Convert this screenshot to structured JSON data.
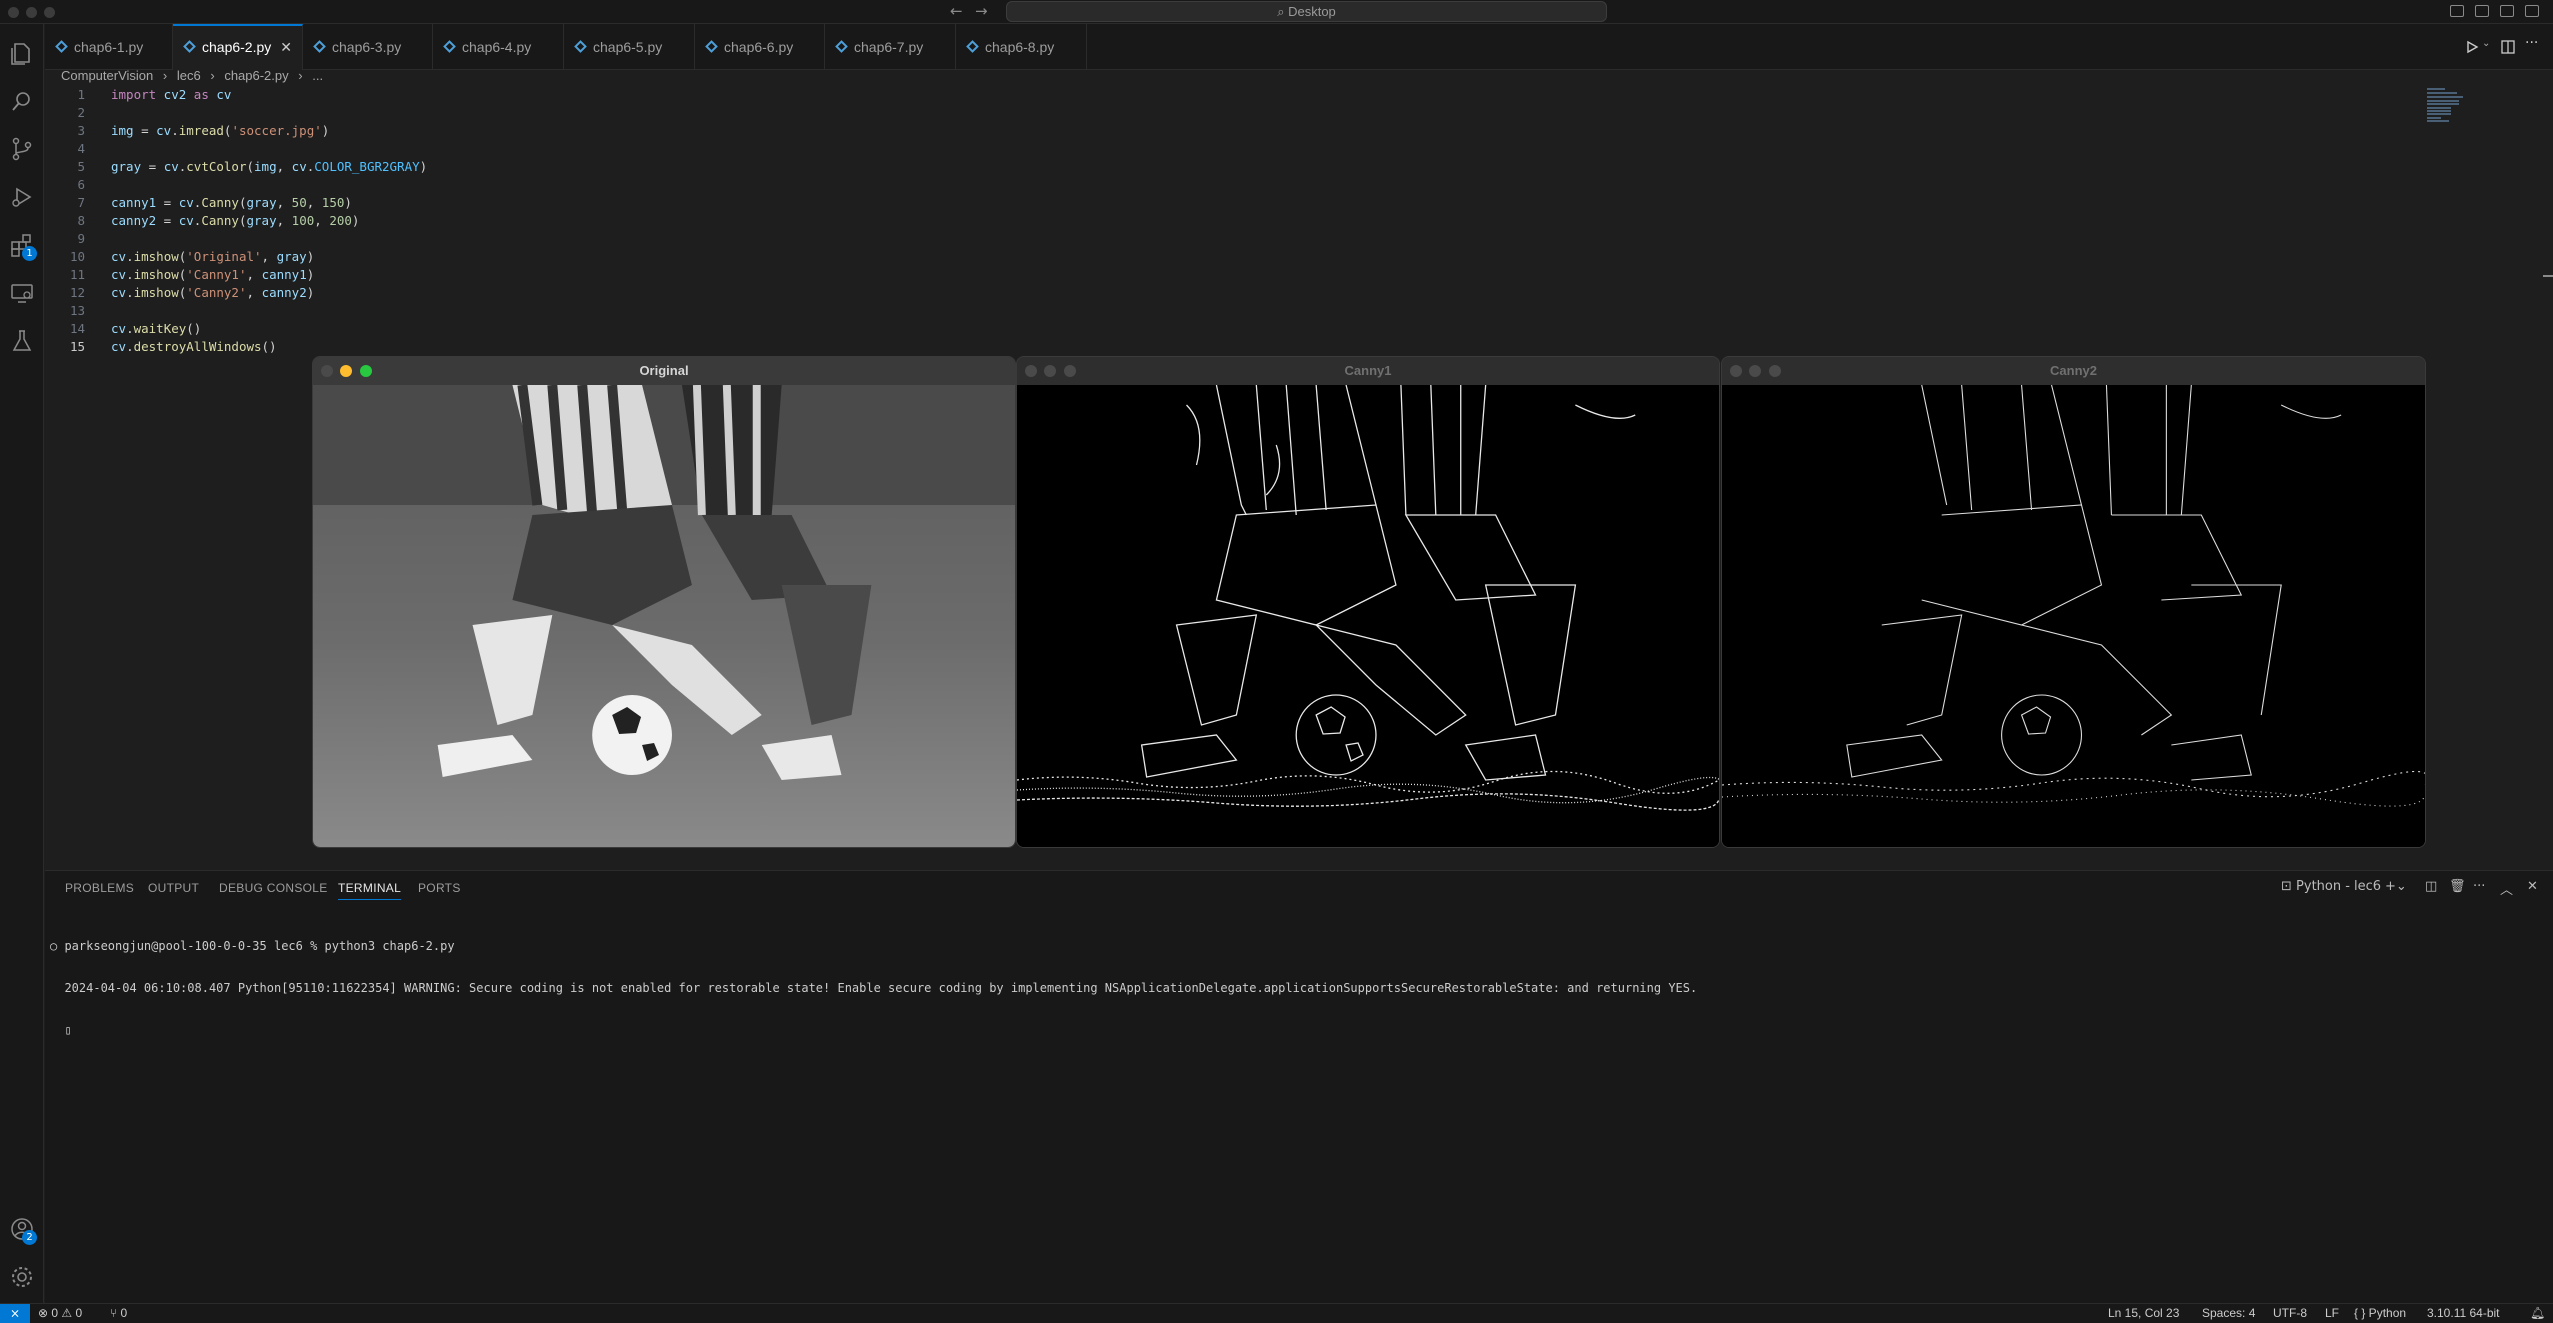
{
  "titlebar": {
    "search_label": "⌕ Desktop"
  },
  "tabs": [
    {
      "label": "chap6-1.py"
    },
    {
      "label": "chap6-2.py",
      "active": true
    },
    {
      "label": "chap6-3.py"
    },
    {
      "label": "chap6-4.py"
    },
    {
      "label": "chap6-5.py"
    },
    {
      "label": "chap6-6.py"
    },
    {
      "label": "chap6-7.py"
    },
    {
      "label": "chap6-8.py"
    }
  ],
  "breadcrumb": [
    "ComputerVision",
    "›",
    "lec6",
    "›",
    "chap6-2.py",
    "›",
    "..."
  ],
  "editor": {
    "lines": [
      "1",
      "2",
      "3",
      "4",
      "5",
      "6",
      "7",
      "8",
      "9",
      "10",
      "11",
      "12",
      "13",
      "14",
      "15"
    ],
    "code": {
      "l1_kw1": "import",
      "l1_mod": " cv2 ",
      "l1_kw2": "as",
      "l1_alias": " cv",
      "l3_var": "img",
      "l3_eq": " = ",
      "l3_mod": "cv",
      "l3_dot": ".",
      "l3_fn": "imread",
      "l3_open": "(",
      "l3_str": "'soccer.jpg'",
      "l3_close": ")",
      "l5_var": "gray",
      "l5_eq": " = ",
      "l5_mod": "cv",
      "l5_dot": ".",
      "l5_fn": "cvtColor",
      "l5_open": "(",
      "l5_arg1": "img",
      "l5_sep": ", ",
      "l5_mod2": "cv",
      "l5_dot2": ".",
      "l5_const": "COLOR_BGR2GRAY",
      "l5_close": ")",
      "l7_var": "canny1",
      "l7_eq": " = ",
      "l7_mod": "cv",
      "l7_dot": ".",
      "l7_fn": "Canny",
      "l7_open": "(",
      "l7_arg": "gray",
      "l7_sep1": ", ",
      "l7_n1": "50",
      "l7_sep2": ", ",
      "l7_n2": "150",
      "l7_close": ")",
      "l8_var": "canny2",
      "l8_eq": " = ",
      "l8_mod": "cv",
      "l8_dot": ".",
      "l8_fn": "Canny",
      "l8_open": "(",
      "l8_arg": "gray",
      "l8_sep1": ", ",
      "l8_n1": "100",
      "l8_sep2": ", ",
      "l8_n2": "200",
      "l8_close": ")",
      "l10_mod": "cv",
      "l10_dot": ".",
      "l10_fn": "imshow",
      "l10_open": "(",
      "l10_str": "'Original'",
      "l10_sep": ", ",
      "l10_arg": "gray",
      "l10_close": ")",
      "l11_mod": "cv",
      "l11_dot": ".",
      "l11_fn": "imshow",
      "l11_open": "(",
      "l11_str": "'Canny1'",
      "l11_sep": ", ",
      "l11_arg": "canny1",
      "l11_close": ")",
      "l12_mod": "cv",
      "l12_dot": ".",
      "l12_fn": "imshow",
      "l12_open": "(",
      "l12_str": "'Canny2'",
      "l12_sep": ", ",
      "l12_arg": "canny2",
      "l12_close": ")",
      "l14_mod": "cv",
      "l14_dot": ".",
      "l14_fn": "waitKey",
      "l14_paren": "()",
      "l15_mod": "cv",
      "l15_dot": ".",
      "l15_fn": "destroyAllWindows",
      "l15_paren": "()"
    }
  },
  "cv_windows": [
    {
      "title": "Original",
      "state": "active"
    },
    {
      "title": "Canny1",
      "state": "inactive"
    },
    {
      "title": "Canny2",
      "state": "inactive"
    }
  ],
  "panel": {
    "tabs": [
      "PROBLEMS",
      "OUTPUT",
      "DEBUG CONSOLE",
      "TERMINAL",
      "PORTS"
    ],
    "active_tab": "TERMINAL",
    "terminal_profile": "Python - lec6",
    "terminal_lines": [
      "○ parkseongjun@pool-100-0-0-35 lec6 % python3 chap6-2.py",
      "  2024-04-04 06:10:08.407 Python[95110:11622354] WARNING: Secure coding is not enabled for restorable state! Enable secure coding by implementing NSApplicationDelegate.applicationSupportsSecureRestorableState: and returning YES.",
      "  ▯"
    ]
  },
  "activity": {
    "extensions_badge": "1",
    "accounts_badge": "2"
  },
  "statusbar": {
    "problems": "⊗ 0 ⚠ 0",
    "ports": "⑂ 0",
    "cursor": "Ln 15, Col 23",
    "spaces": "Spaces: 4",
    "encoding": "UTF-8",
    "eol": "LF",
    "language": "{ } Python",
    "interpreter": "3.10.11 64-bit"
  },
  "colors": {
    "accent": "#0078d4",
    "editor_bg": "#1e1e1e",
    "panel_bg": "#181818"
  }
}
